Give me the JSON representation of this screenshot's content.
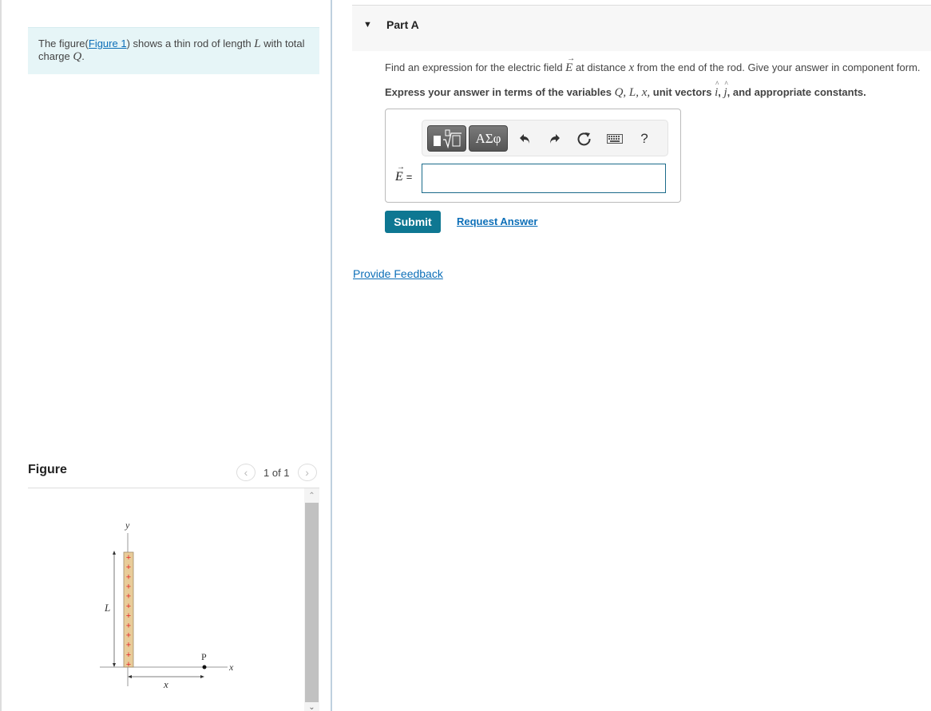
{
  "intro": {
    "prefix": "The figure(",
    "link": "Figure 1",
    "middle": ") shows a thin rod of length ",
    "var_L": "L",
    "after_L": " with total charge ",
    "var_Q": "Q",
    "end": "."
  },
  "figure": {
    "title": "Figure",
    "counter": "1 of 1",
    "prev_icon": "chevron-left-icon",
    "next_icon": "chevron-right-icon",
    "labels": {
      "y_axis": "y",
      "x_axis": "x",
      "length": "L",
      "point": "P",
      "distance": "x",
      "charge_symbol": "+"
    },
    "charge_count": 12,
    "colors": {
      "rod_fill": "#e8cc99",
      "charge": "#e8252a",
      "axis": "#999999"
    }
  },
  "part": {
    "toggle_icon": "triangle-down-icon",
    "title": "Part A"
  },
  "question": {
    "text1": "Find an expression for the electric field ",
    "var_E": "E",
    "text2": " at distance ",
    "var_x": "x",
    "text3": " from the end of the rod. Give your answer in component form."
  },
  "instructions": {
    "text1": "Express your answer in terms of the variables ",
    "vars": "Q, L, x,",
    "text2": " unit vectors ",
    "unit_i": "i",
    "comma": ", ",
    "unit_j": "j",
    "text3": ", and appropriate constants."
  },
  "toolbar": {
    "templates_icon": "templates-icon",
    "symbols_label": "ΑΣφ",
    "undo_icon": "undo-icon",
    "redo_icon": "redo-icon",
    "reset_icon": "reset-icon",
    "keyboard_icon": "keyboard-icon",
    "help_label": "?"
  },
  "answer": {
    "label_var": "E",
    "equals": "=",
    "value": ""
  },
  "actions": {
    "submit": "Submit",
    "request_answer": "Request Answer",
    "feedback": "Provide Feedback"
  },
  "colors": {
    "accent": "#0e7792",
    "link": "#0d6fb8",
    "intro_bg": "#e6f5f7"
  }
}
